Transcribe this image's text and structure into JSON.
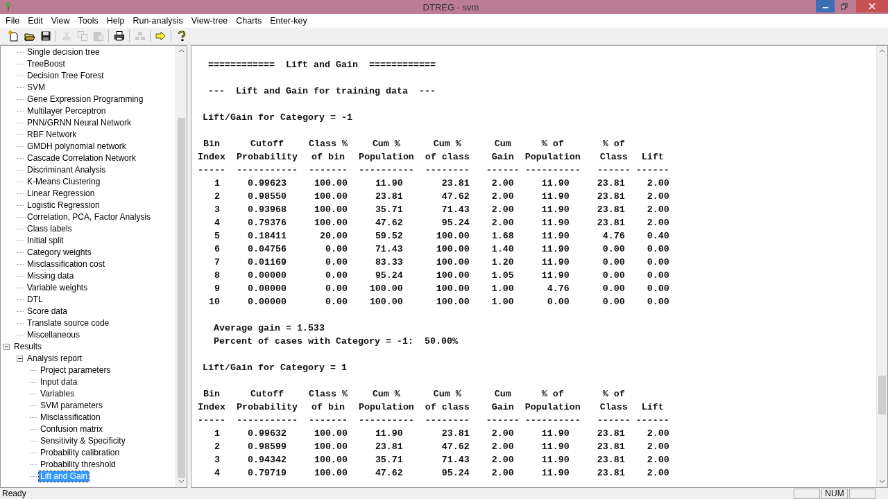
{
  "window": {
    "title": "DTREG - svm"
  },
  "menu": [
    "File",
    "Edit",
    "View",
    "Tools",
    "Help",
    "Run-analysis",
    "View-tree",
    "Charts",
    "Enter-key"
  ],
  "toolbar": [
    {
      "kind": "new",
      "disabled": false
    },
    {
      "kind": "open",
      "disabled": false
    },
    {
      "kind": "save",
      "disabled": false
    },
    {
      "kind": "sep"
    },
    {
      "kind": "cut",
      "disabled": true
    },
    {
      "kind": "copy",
      "disabled": true
    },
    {
      "kind": "paste",
      "disabled": true
    },
    {
      "kind": "sep"
    },
    {
      "kind": "print",
      "disabled": false
    },
    {
      "kind": "sep"
    },
    {
      "kind": "network",
      "disabled": true
    },
    {
      "kind": "sep"
    },
    {
      "kind": "run",
      "disabled": false
    },
    {
      "kind": "sep"
    },
    {
      "kind": "help",
      "disabled": false
    }
  ],
  "tree": {
    "continued_items": [
      {
        "label": "Single decision tree",
        "selected": false
      },
      {
        "label": "TreeBoost",
        "selected": false
      },
      {
        "label": "Decision Tree Forest",
        "selected": false
      },
      {
        "label": "SVM",
        "selected": false
      },
      {
        "label": "Gene Expression Programming",
        "selected": false
      },
      {
        "label": "Multilayer Perceptron",
        "selected": false
      },
      {
        "label": "PNN/GRNN Neural Network",
        "selected": false
      },
      {
        "label": "RBF Network",
        "selected": false
      },
      {
        "label": "GMDH polynomial network",
        "selected": false
      },
      {
        "label": "Cascade Correlation Network",
        "selected": false
      },
      {
        "label": "Discriminant Analysis",
        "selected": false
      },
      {
        "label": "K-Means Clustering",
        "selected": false
      },
      {
        "label": "Linear Regression",
        "selected": false
      },
      {
        "label": "Logistic Regression",
        "selected": false
      },
      {
        "label": "Correlation, PCA, Factor Analysis",
        "selected": false
      },
      {
        "label": "Class labels",
        "selected": false
      },
      {
        "label": "Initial split",
        "selected": false
      },
      {
        "label": "Category weights",
        "selected": false
      },
      {
        "label": "Misclassification cost",
        "selected": false
      },
      {
        "label": "Missing data",
        "selected": false
      },
      {
        "label": "Variable weights",
        "selected": false
      },
      {
        "label": "DTL",
        "selected": false
      },
      {
        "label": "Score data",
        "selected": false
      },
      {
        "label": "Translate source code",
        "selected": false
      },
      {
        "label": "Miscellaneous",
        "selected": false
      }
    ],
    "nodes": [
      {
        "label": "Results",
        "selected": false,
        "expanded": true,
        "children": [
          {
            "label": "Analysis report",
            "selected": false,
            "expanded": true,
            "children": [
              {
                "label": "Project parameters",
                "selected": false
              },
              {
                "label": "Input data",
                "selected": false
              },
              {
                "label": "Variables",
                "selected": false
              },
              {
                "label": "SVM parameters",
                "selected": false
              },
              {
                "label": "Misclassification",
                "selected": false
              },
              {
                "label": "Confusion matrix",
                "selected": false
              },
              {
                "label": "Sensitivity & Specificity",
                "selected": false
              },
              {
                "label": "Probability calibration",
                "selected": false
              },
              {
                "label": "Probability threshold",
                "selected": false
              },
              {
                "label": "Lift and Gain",
                "selected": true
              }
            ]
          }
        ]
      }
    ]
  },
  "report": [
    {
      "kind": "heading",
      "text": "============  Lift and Gain  ============"
    },
    {
      "kind": "subheading",
      "text": "---  Lift and Gain for training data  ---"
    },
    {
      "kind": "category",
      "text": "Lift/Gain for Category = -1"
    },
    {
      "kind": "table",
      "columns": [
        {
          "header": [
            "Bin",
            "Index"
          ],
          "rule": "-----"
        },
        {
          "header": [
            "Cutoff",
            "Probability"
          ],
          "rule": "-----------"
        },
        {
          "header": [
            "Class %",
            "of bin"
          ],
          "rule": "-------"
        },
        {
          "header": [
            "Cum %",
            "Population"
          ],
          "rule": "----------"
        },
        {
          "header": [
            "Cum %",
            "of class"
          ],
          "rule": "--------"
        },
        {
          "header": [
            "Cum",
            "Gain"
          ],
          "rule": "------"
        },
        {
          "header": [
            "% of",
            "Population"
          ],
          "rule": "----------"
        },
        {
          "header": [
            "% of",
            "Class"
          ],
          "rule": "------"
        },
        {
          "header": [
            "Lift"
          ],
          "rule": "------"
        }
      ],
      "rows": [
        [
          "1",
          "0.99623",
          "100.00",
          "11.90",
          "23.81",
          "2.00",
          "11.90",
          "23.81",
          "2.00"
        ],
        [
          "2",
          "0.98550",
          "100.00",
          "23.81",
          "47.62",
          "2.00",
          "11.90",
          "23.81",
          "2.00"
        ],
        [
          "3",
          "0.93968",
          "100.00",
          "35.71",
          "71.43",
          "2.00",
          "11.90",
          "23.81",
          "2.00"
        ],
        [
          "4",
          "0.79376",
          "100.00",
          "47.62",
          "95.24",
          "2.00",
          "11.90",
          "23.81",
          "2.00"
        ],
        [
          "5",
          "0.18411",
          "20.00",
          "59.52",
          "100.00",
          "1.68",
          "11.90",
          "4.76",
          "0.40"
        ],
        [
          "6",
          "0.04756",
          "0.00",
          "71.43",
          "100.00",
          "1.40",
          "11.90",
          "0.00",
          "0.00"
        ],
        [
          "7",
          "0.01169",
          "0.00",
          "83.33",
          "100.00",
          "1.20",
          "11.90",
          "0.00",
          "0.00"
        ],
        [
          "8",
          "0.00000",
          "0.00",
          "95.24",
          "100.00",
          "1.05",
          "11.90",
          "0.00",
          "0.00"
        ],
        [
          "9",
          "0.00000",
          "0.00",
          "100.00",
          "100.00",
          "1.00",
          "4.76",
          "0.00",
          "0.00"
        ],
        [
          "10",
          "0.00000",
          "0.00",
          "100.00",
          "100.00",
          "1.00",
          "0.00",
          "0.00",
          "0.00"
        ]
      ]
    },
    {
      "kind": "note",
      "lines": [
        "Average gain = 1.533",
        "Percent of cases with Category = -1:  50.00%"
      ]
    },
    {
      "kind": "category",
      "text": "Lift/Gain for Category = 1"
    },
    {
      "kind": "table",
      "columns": [
        {
          "header": [
            "Bin",
            "Index"
          ],
          "rule": "-----"
        },
        {
          "header": [
            "Cutoff",
            "Probability"
          ],
          "rule": "-----------"
        },
        {
          "header": [
            "Class %",
            "of bin"
          ],
          "rule": "-------"
        },
        {
          "header": [
            "Cum %",
            "Population"
          ],
          "rule": "----------"
        },
        {
          "header": [
            "Cum %",
            "of class"
          ],
          "rule": "--------"
        },
        {
          "header": [
            "Cum",
            "Gain"
          ],
          "rule": "------"
        },
        {
          "header": [
            "% of",
            "Population"
          ],
          "rule": "----------"
        },
        {
          "header": [
            "% of",
            "Class"
          ],
          "rule": "------"
        },
        {
          "header": [
            "Lift"
          ],
          "rule": "------"
        }
      ],
      "rows": [
        [
          "1",
          "0.99632",
          "100.00",
          "11.90",
          "23.81",
          "2.00",
          "11.90",
          "23.81",
          "2.00"
        ],
        [
          "2",
          "0.98599",
          "100.00",
          "23.81",
          "47.62",
          "2.00",
          "11.90",
          "23.81",
          "2.00"
        ],
        [
          "3",
          "0.94342",
          "100.00",
          "35.71",
          "71.43",
          "2.00",
          "11.90",
          "23.81",
          "2.00"
        ],
        [
          "4",
          "0.79719",
          "100.00",
          "47.62",
          "95.24",
          "2.00",
          "11.90",
          "23.81",
          "2.00"
        ]
      ]
    }
  ],
  "status_bar": {
    "text": "Ready",
    "num_indicator": "NUM"
  }
}
